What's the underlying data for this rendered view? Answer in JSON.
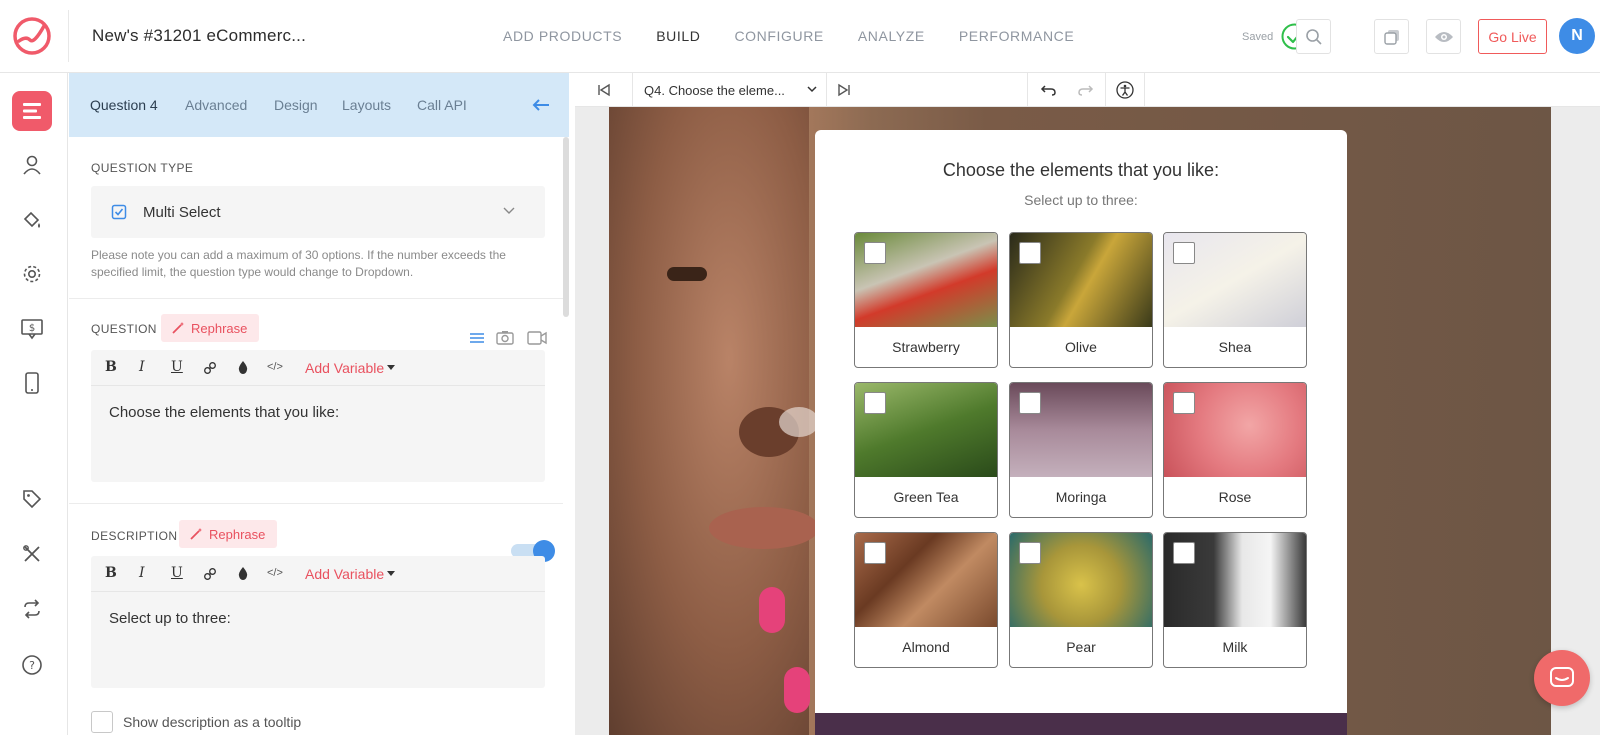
{
  "header": {
    "survey_title": "New's #31201 eCommerc...",
    "nav": [
      "ADD PRODUCTS",
      "BUILD",
      "CONFIGURE",
      "ANALYZE",
      "PERFORMANCE"
    ],
    "active_nav": "BUILD",
    "saved_label": "Saved",
    "go_live": "Go Live",
    "avatar_initial": "N",
    "brand_color": "#f05a6a"
  },
  "panel": {
    "tabs": [
      "Question 4",
      "Advanced",
      "Design",
      "Layouts",
      "Call API"
    ],
    "question_type_label": "QUESTION TYPE",
    "question_type_value": "Multi Select",
    "note": "Please note you can add a maximum of 30 options. If the number exceeds the specified limit, the question type would change to Dropdown.",
    "question_label": "QUESTION",
    "rephrase": "Rephrase",
    "add_variable": "Add Variable",
    "question_text": "Choose the elements that you like:",
    "description_label": "DESCRIPTION",
    "description_text": "Select up to three:",
    "tooltip_label": "Show description as a tooltip",
    "toolbar": {
      "bold": "B",
      "italic": "I",
      "underline": "U"
    }
  },
  "preview": {
    "question_selector": "Q4. Choose the eleme...",
    "title": "Choose the elements that you like:",
    "subtitle": "Select up to three:",
    "options": [
      {
        "label": "Strawberry",
        "color": "#7a8f4a"
      },
      {
        "label": "Olive",
        "color": "#5c5a2a"
      },
      {
        "label": "Shea",
        "color": "#dcdce4"
      },
      {
        "label": "Green Tea",
        "color": "#4f7a2c"
      },
      {
        "label": "Moringa",
        "color": "#9a7a8a"
      },
      {
        "label": "Rose",
        "color": "#e78a8e"
      },
      {
        "label": "Almond",
        "color": "#8c5a3a"
      },
      {
        "label": "Pear",
        "color": "#b9a63a"
      },
      {
        "label": "Milk",
        "color": "#3a3a3a"
      }
    ]
  }
}
